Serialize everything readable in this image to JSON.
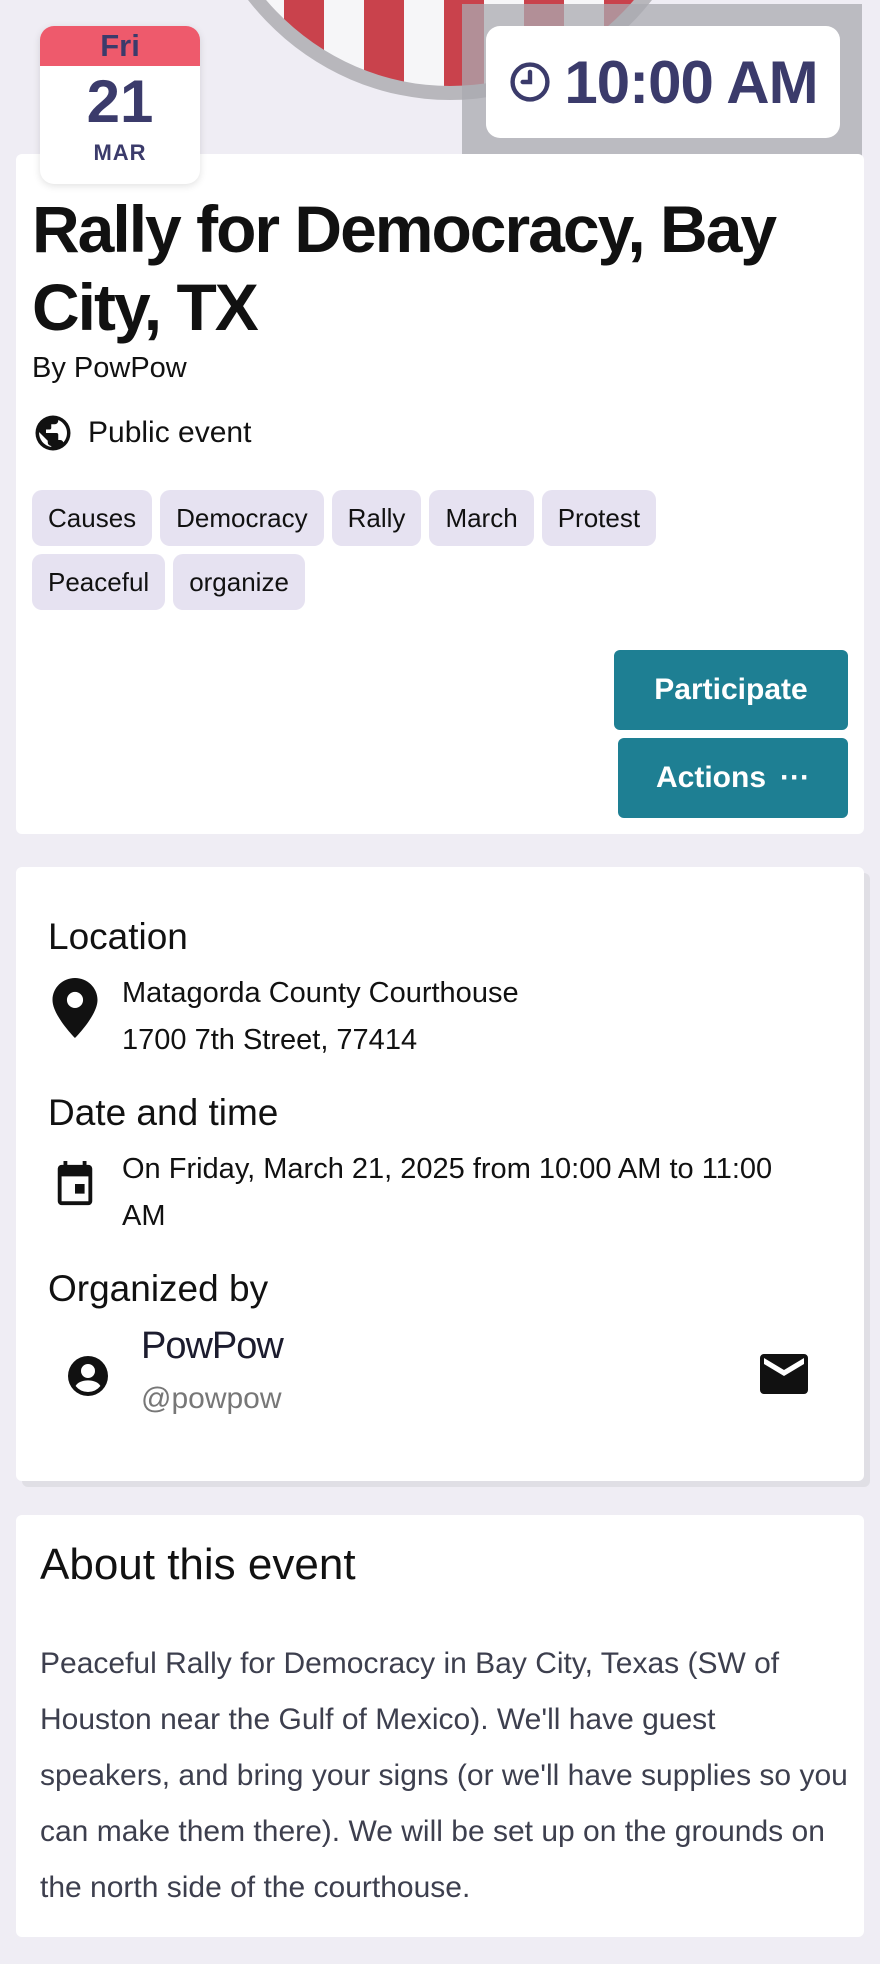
{
  "header": {
    "date_badge": {
      "weekday": "Fri",
      "day": "21",
      "month": "MAR"
    },
    "time": "10:00 AM",
    "icons": {
      "clock": "clock-icon"
    }
  },
  "event": {
    "title": "Rally for Democracy, Bay City, TX",
    "by": "By PowPow",
    "visibility": "Public event",
    "tags": [
      "Causes",
      "Democracy",
      "Rally",
      "March",
      "Protest",
      "Peaceful",
      "organize"
    ],
    "participate_label": "Participate",
    "actions_label": "Actions",
    "actions_more": "···"
  },
  "details": {
    "location_heading": "Location",
    "location_name": "Matagorda County Courthouse",
    "location_address": "1700 7th Street, 77414",
    "datetime_heading": "Date and time",
    "datetime_text": "On Friday, March 21, 2025 from 10:00 AM to 11:00 AM",
    "organizer_heading": "Organized by",
    "organizer_name": "PowPow",
    "organizer_handle": "@powpow"
  },
  "about": {
    "heading": "About this event",
    "text": "Peaceful Rally for Democracy in Bay City, Texas (SW of Houston near the Gulf of Mexico). We'll have guest speakers, and bring your signs (or we'll have supplies so you can make them there). We will be set up on the grounds on the north side of the courthouse."
  },
  "colors": {
    "accent": "#1e7f93",
    "badge_red": "#ee5a6c",
    "badge_text": "#3b3b6b",
    "tag_bg": "#e6e2f1",
    "page_bg": "#efedf4"
  }
}
